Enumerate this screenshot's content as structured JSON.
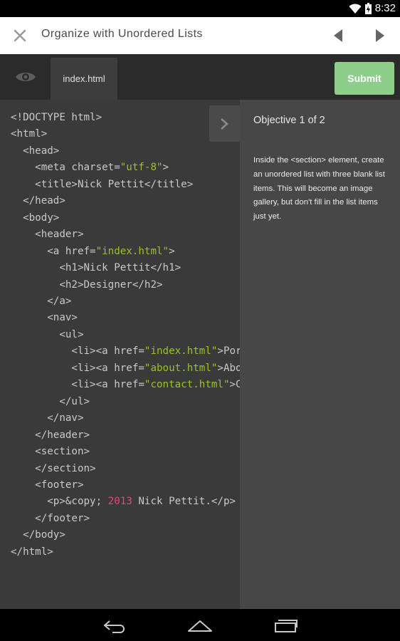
{
  "status_bar": {
    "time": "8:32"
  },
  "header": {
    "title": "Organize with Unordered Lists",
    "close_icon": "close-icon",
    "prev_icon": "triangle-left-icon",
    "next_icon": "triangle-right-icon"
  },
  "toolbar": {
    "tab_label": "index.html",
    "submit_label": "Submit",
    "submit_color": "#8dcf8a"
  },
  "editor": {
    "lines": [
      [
        {
          "t": "<!DOCTYPE html>"
        }
      ],
      [
        {
          "t": "<html>"
        }
      ],
      [
        {
          "t": "  <head>"
        }
      ],
      [
        {
          "t": "    <meta charset="
        },
        {
          "t": "\"utf-8\"",
          "c": "str"
        },
        {
          "t": ">"
        }
      ],
      [
        {
          "t": "    <title>Nick Pettit</title>"
        }
      ],
      [
        {
          "t": "  </head>"
        }
      ],
      [
        {
          "t": "  <body>"
        }
      ],
      [
        {
          "t": "    <header>"
        }
      ],
      [
        {
          "t": "      <a href="
        },
        {
          "t": "\"index.html\"",
          "c": "str"
        },
        {
          "t": ">"
        }
      ],
      [
        {
          "t": "        <h1>Nick Pettit</h1>"
        }
      ],
      [
        {
          "t": "        <h2>Designer</h2>"
        }
      ],
      [
        {
          "t": "      </a>"
        }
      ],
      [
        {
          "t": "      <nav>"
        }
      ],
      [
        {
          "t": "        <ul>"
        }
      ],
      [
        {
          "t": "          <li><a href="
        },
        {
          "t": "\"index.html\"",
          "c": "str"
        },
        {
          "t": ">Portfolio</a></li>"
        }
      ],
      [
        {
          "t": "          <li><a href="
        },
        {
          "t": "\"about.html\"",
          "c": "str"
        },
        {
          "t": ">About</a></li>"
        }
      ],
      [
        {
          "t": "          <li><a href="
        },
        {
          "t": "\"contact.html\"",
          "c": "str"
        },
        {
          "t": ">Contact</a></li>"
        }
      ],
      [
        {
          "t": "        </ul>"
        }
      ],
      [
        {
          "t": "      </nav>"
        }
      ],
      [
        {
          "t": "    </header>"
        }
      ],
      [
        {
          "t": "    <section>"
        }
      ],
      [
        {
          "t": "    </section>"
        }
      ],
      [
        {
          "t": "    <footer>"
        }
      ],
      [
        {
          "t": "      <p>&copy; "
        },
        {
          "t": "2013",
          "c": "num"
        },
        {
          "t": " Nick Pettit.</p>"
        }
      ],
      [
        {
          "t": "    </footer>"
        }
      ],
      [
        {
          "t": "  </body>"
        }
      ],
      [
        {
          "t": "</html>"
        }
      ]
    ],
    "colors": {
      "text": "#c9c9c9",
      "string": "#99c22a",
      "number": "#e0487a"
    }
  },
  "objective": {
    "heading": "Objective 1 of 2",
    "text": "Inside the <section> element, create an unordered list with three blank list items. This will become an image gallery, but don't fill in the list items just yet."
  }
}
